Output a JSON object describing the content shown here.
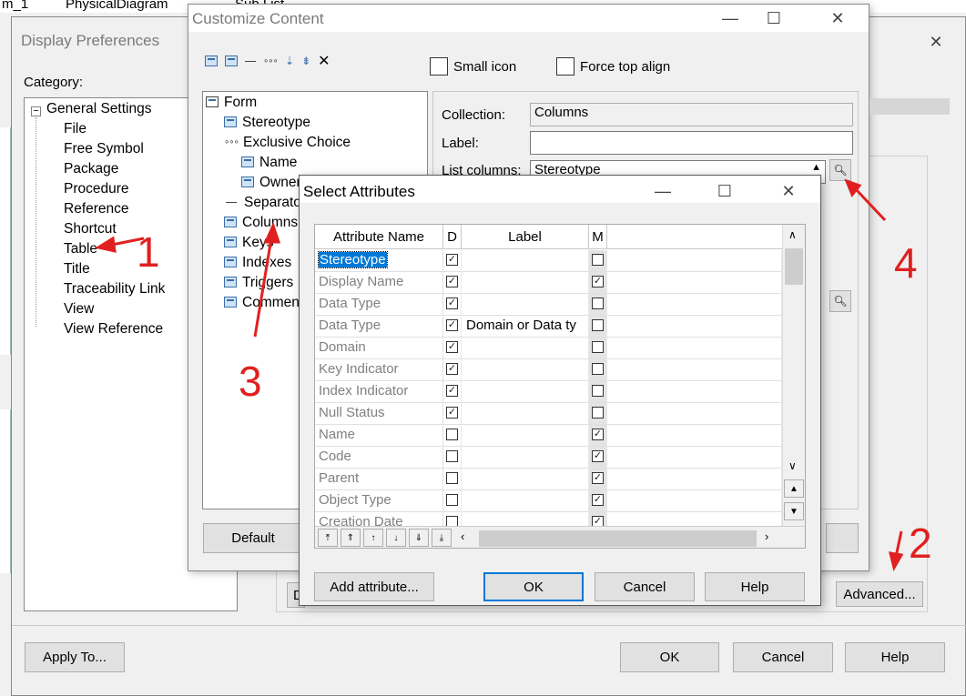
{
  "background_tabs": [
    "m_1",
    "PhysicalDiagram",
    "Sub List"
  ],
  "display_preferences": {
    "title": "Display Preferences",
    "category_label": "Category:",
    "tree_root": "General Settings",
    "tree_items": [
      "File",
      "Free Symbol",
      "Package",
      "Procedure",
      "Reference",
      "Shortcut",
      "Table",
      "Title",
      "Traceability Link",
      "View",
      "View Reference"
    ],
    "apply_to_label": "Apply To...",
    "ok_label": "OK",
    "cancel_label": "Cancel",
    "help_label": "Help",
    "advanced_label": "Advanced...",
    "partial_button": "D"
  },
  "customize_content": {
    "title": "Customize Content",
    "small_icon_label": "Small icon",
    "force_top_align_label": "Force top align",
    "tree": [
      {
        "label": "Form",
        "kind": "table"
      },
      {
        "label": "Stereotype",
        "kind": "icon"
      },
      {
        "label": "Exclusive Choice",
        "kind": "dots"
      },
      {
        "label": "Name",
        "kind": "icon"
      },
      {
        "label": "Owner",
        "kind": "icon"
      },
      {
        "label": "Separator",
        "kind": "dash"
      },
      {
        "label": "Columns",
        "kind": "icon"
      },
      {
        "label": "Keys",
        "kind": "icon"
      },
      {
        "label": "Indexes",
        "kind": "icon"
      },
      {
        "label": "Triggers",
        "kind": "icon"
      },
      {
        "label": "Comment",
        "kind": "icon"
      }
    ],
    "collection_label": "Collection:",
    "collection_value": "Columns",
    "label_label": "Label:",
    "label_value": "",
    "list_columns_label": "List columns:",
    "list_columns_value": "Stereotype",
    "default_label": "Default"
  },
  "select_attributes": {
    "title": "Select Attributes",
    "headers": {
      "name": "Attribute Name",
      "d": "D",
      "label": "Label",
      "m": "M"
    },
    "rows": [
      {
        "name": "Stereotype",
        "d": true,
        "label": "",
        "m": false,
        "selected": true
      },
      {
        "name": "Display Name",
        "d": true,
        "label": "",
        "m": true
      },
      {
        "name": "Data Type",
        "d": true,
        "label": "",
        "m": false
      },
      {
        "name": "Data Type",
        "d": true,
        "label": "Domain or Data ty",
        "m": false
      },
      {
        "name": "Domain",
        "d": true,
        "label": "",
        "m": false
      },
      {
        "name": "Key Indicator",
        "d": true,
        "label": "",
        "m": false
      },
      {
        "name": "Index Indicator",
        "d": true,
        "label": "",
        "m": false
      },
      {
        "name": "Null Status",
        "d": true,
        "label": "",
        "m": false
      },
      {
        "name": "Name",
        "d": false,
        "label": "",
        "m": true
      },
      {
        "name": "Code",
        "d": false,
        "label": "",
        "m": true
      },
      {
        "name": "Parent",
        "d": false,
        "label": "",
        "m": true
      },
      {
        "name": "Object Type",
        "d": false,
        "label": "",
        "m": true
      },
      {
        "name": "Creation Date",
        "d": false,
        "label": "",
        "m": true
      }
    ],
    "add_attribute_label": "Add attribute...",
    "ok_label": "OK",
    "cancel_label": "Cancel",
    "help_label": "Help"
  },
  "annotations": [
    "1",
    "2",
    "3",
    "4"
  ],
  "colors": {
    "annotation": "#e02020",
    "selection": "#0078d7"
  }
}
